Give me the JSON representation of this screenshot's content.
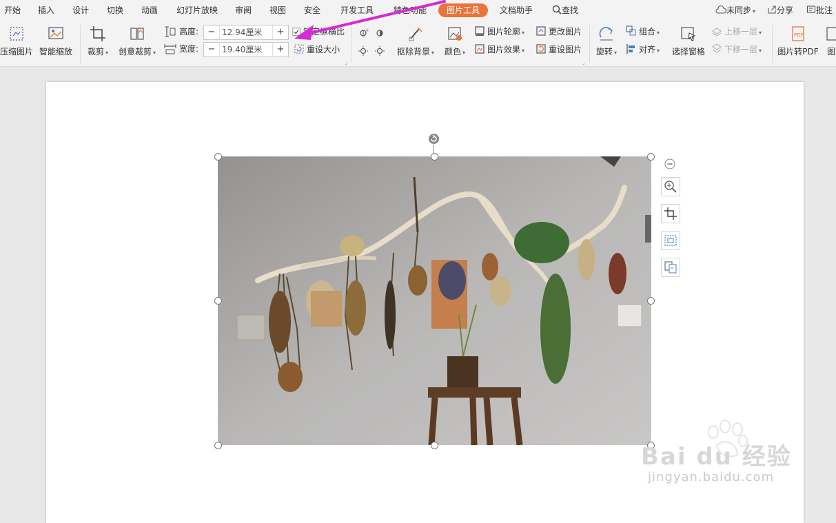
{
  "menu": {
    "tabs": [
      "开始",
      "插入",
      "设计",
      "切换",
      "动画",
      "幻灯片放映",
      "审阅",
      "视图",
      "安全",
      "开发工具",
      "特色功能",
      "图片工具",
      "文档助手"
    ],
    "active_tab": "图片工具",
    "search_label": "查找",
    "sync_label": "未同步",
    "share_label": "分享",
    "comment_label": "批注"
  },
  "ribbon": {
    "compress_label": "压缩图片",
    "smart_zoom_label": "智能缩放",
    "crop_label": "裁剪",
    "creative_crop_label": "创意裁剪",
    "height_label": "高度:",
    "height_value": "12.94厘米",
    "width_label": "宽度:",
    "width_value": "19.40厘米",
    "lock_ratio_label": "锁定纵横比",
    "reset_size_label": "重设大小",
    "remove_bg_label": "抠除背景",
    "color_label": "颜色",
    "outline_label": "图片轮廓",
    "effect_label": "图片效果",
    "change_pic_label": "更改图片",
    "reset_pic_label": "重设图片",
    "rotate_label": "旋转",
    "group_label": "组合",
    "align_label": "对齐",
    "selection_pane_label": "选择窗格",
    "bring_forward_label": "上移一层",
    "send_backward_label": "下移一层",
    "to_pdf_label": "图片转PDF",
    "more_label": "图"
  },
  "colors": {
    "accent": "#e9743c",
    "arrow": "#d42ad8"
  },
  "watermark": {
    "brand": "Bai du 经验",
    "url": "jingyan.baidu.com"
  }
}
